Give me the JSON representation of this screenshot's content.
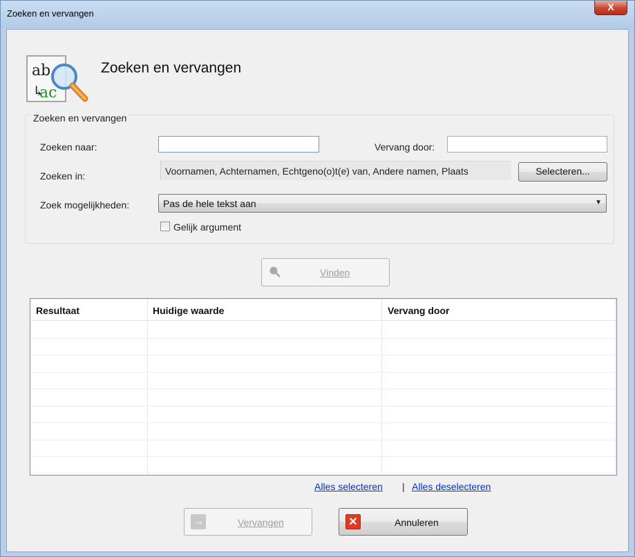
{
  "window": {
    "title": "Zoeken en vervangen",
    "close_glyph": "X"
  },
  "header": {
    "title": "Zoeken en vervangen",
    "icon": "find-replace-icon",
    "icon_text_top": "ab",
    "icon_text_bottom": "ac"
  },
  "group": {
    "legend": "Zoeken en vervangen",
    "search_for_label": "Zoeken naar:",
    "search_for_value": "",
    "replace_with_label": "Vervang door:",
    "replace_with_value": "",
    "search_in_label": "Zoeken in:",
    "search_in_value": "Voornamen, Achternamen, Echtgeno(o)t(e) van, Andere namen, Plaats",
    "select_button": "Selecteren...",
    "options_label": "Zoek mogelijkheden:",
    "options_value": "Pas de hele tekst aan",
    "match_case_label": "Gelijk argument",
    "match_case_checked": false
  },
  "find_button": {
    "label": "Vinden",
    "icon": "search-icon",
    "enabled": false
  },
  "results": {
    "columns": [
      "Resultaat",
      "Huidige waarde",
      "Vervang door"
    ],
    "rows": []
  },
  "links": {
    "select_all": "Alles selecteren",
    "separator": "|",
    "deselect_all": "Alles deselecteren"
  },
  "footer": {
    "replace_label": "Vervangen",
    "replace_icon": "arrow-right-icon",
    "replace_enabled": false,
    "cancel_label": "Annuleren",
    "cancel_icon": "close-icon"
  },
  "colors": {
    "link": "#0033cc",
    "cancel_icon_bg": "#e03a22",
    "disabled_icon_bg": "#c8c8c8"
  }
}
